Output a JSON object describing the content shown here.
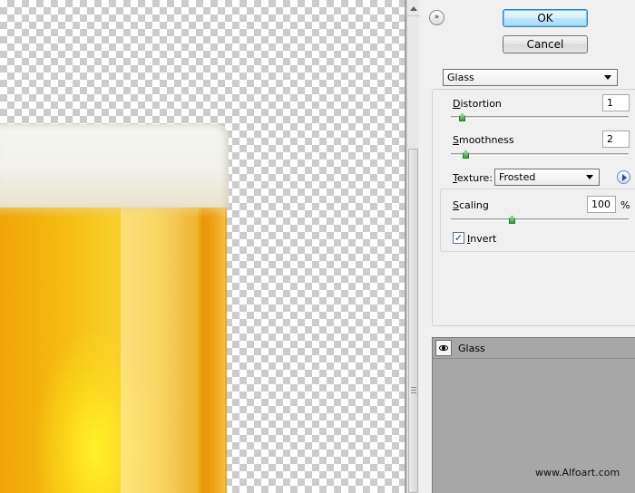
{
  "buttons": {
    "ok_label": "OK",
    "cancel_label": "Cancel",
    "collapse_glyph": "»"
  },
  "filter": {
    "selected": "Glass"
  },
  "distortion": {
    "label_u": "D",
    "label_rest": "istortion",
    "value": "1",
    "slider_level": 0.05
  },
  "smoothness": {
    "label_u": "S",
    "label_rest": "moothness",
    "value": "2",
    "slider_level": 0.07
  },
  "texture": {
    "label_u": "T",
    "label_rest": "exture:",
    "selected": "Frosted"
  },
  "scaling": {
    "label_u": "S",
    "label_rest": "caling",
    "value": "100",
    "unit": "%",
    "slider_level": 0.34
  },
  "invert": {
    "label_u": "I",
    "label_rest": "nvert",
    "checked": true
  },
  "layers": {
    "name": "Glass"
  },
  "watermark": "www.Alfoart.com",
  "colors": {
    "panel_bg": "#f0f0f0",
    "layers_bg": "#a7a7a7",
    "ok_accent": "#3c7fb1",
    "slider_thumb": "#3f9b3f"
  },
  "icons": [
    "collapse-icon",
    "dropdown-arrow-icon",
    "menu-arrow-icon",
    "eye-icon",
    "checkmark-icon"
  ]
}
